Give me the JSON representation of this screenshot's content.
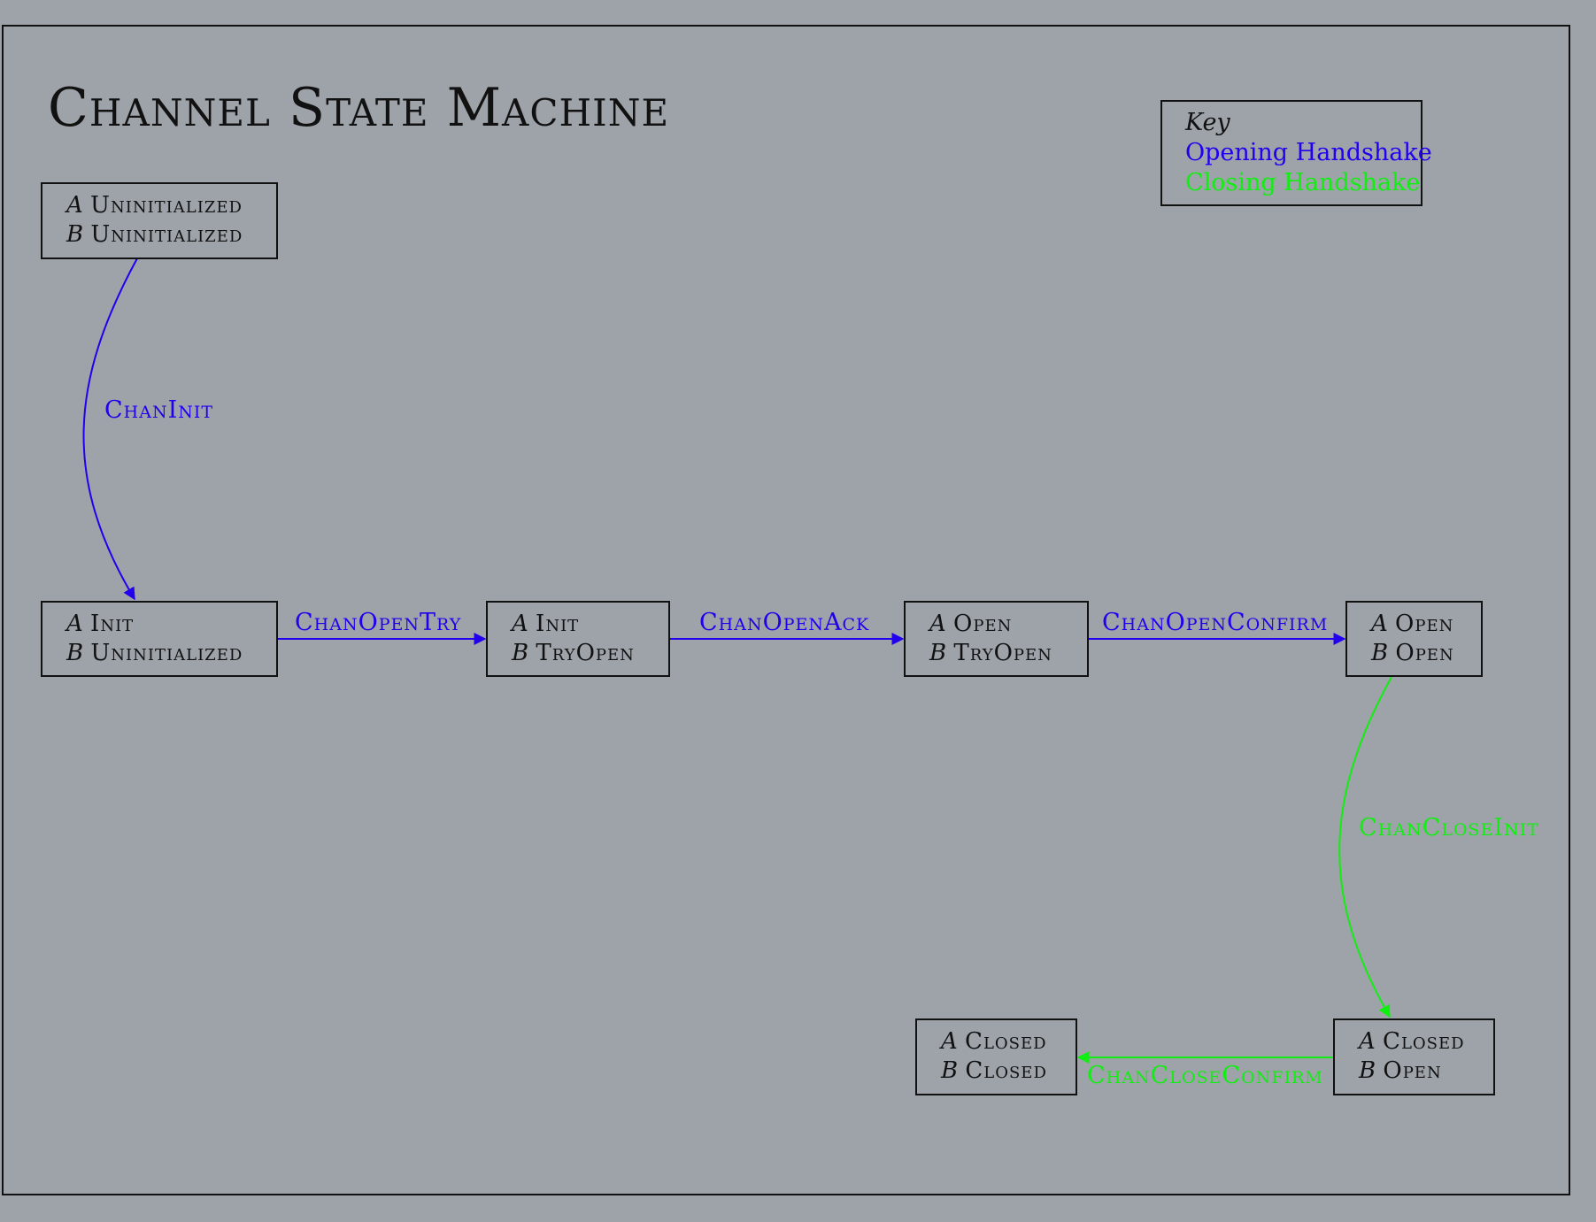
{
  "title": "Channel State Machine",
  "key": {
    "heading": "Key",
    "items": [
      {
        "label": "Opening Handshake",
        "color": "#2200ee"
      },
      {
        "label": "Closing Handshake",
        "color": "#11ee11"
      }
    ]
  },
  "states": [
    {
      "id": "s1",
      "a_party": "A",
      "a_state": "Uninitialized",
      "b_party": "B",
      "b_state": "Uninitialized"
    },
    {
      "id": "s2",
      "a_party": "A",
      "a_state": "Init",
      "b_party": "B",
      "b_state": "Uninitialized"
    },
    {
      "id": "s3",
      "a_party": "A",
      "a_state": "Init",
      "b_party": "B",
      "b_state": "TryOpen"
    },
    {
      "id": "s4",
      "a_party": "A",
      "a_state": "Open",
      "b_party": "B",
      "b_state": "TryOpen"
    },
    {
      "id": "s5",
      "a_party": "A",
      "a_state": "Open",
      "b_party": "B",
      "b_state": "Open"
    },
    {
      "id": "s6",
      "a_party": "A",
      "a_state": "Closed",
      "b_party": "B",
      "b_state": "Open"
    },
    {
      "id": "s7",
      "a_party": "A",
      "a_state": "Closed",
      "b_party": "B",
      "b_state": "Closed"
    }
  ],
  "transitions": [
    {
      "id": "t1",
      "label": "ChanInit",
      "from": "s1",
      "to": "s2",
      "kind": "opening"
    },
    {
      "id": "t2",
      "label": "ChanOpenTry",
      "from": "s2",
      "to": "s3",
      "kind": "opening"
    },
    {
      "id": "t3",
      "label": "ChanOpenAck",
      "from": "s3",
      "to": "s4",
      "kind": "opening"
    },
    {
      "id": "t4",
      "label": "ChanOpenConfirm",
      "from": "s4",
      "to": "s5",
      "kind": "opening"
    },
    {
      "id": "t5",
      "label": "ChanCloseInit",
      "from": "s5",
      "to": "s6",
      "kind": "closing"
    },
    {
      "id": "t6",
      "label": "ChanCloseConfirm",
      "from": "s6",
      "to": "s7",
      "kind": "closing"
    }
  ],
  "colors": {
    "opening": "#2200ee",
    "closing": "#11ee11",
    "background": "#9ea3aa",
    "ink": "#111111"
  }
}
